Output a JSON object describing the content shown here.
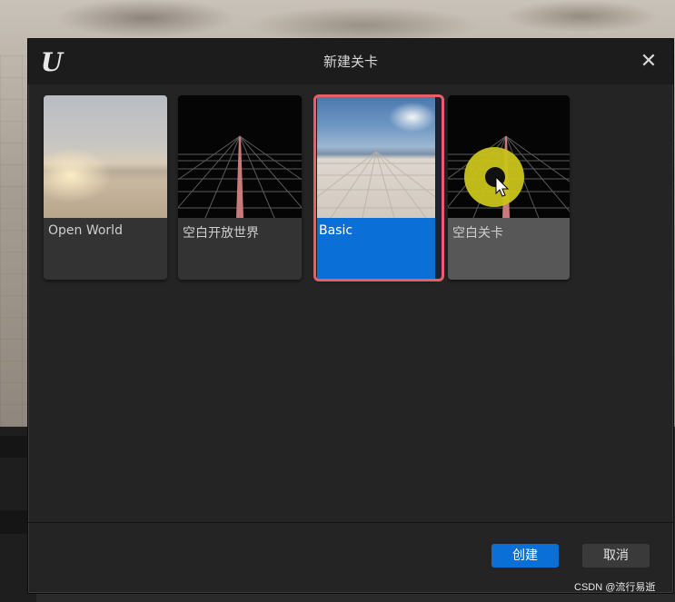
{
  "dialog": {
    "title": "新建关卡",
    "close_label": "✕",
    "logo_text": "U"
  },
  "templates": [
    {
      "label": "Open World",
      "selected": false
    },
    {
      "label": "空白开放世界",
      "selected": false
    },
    {
      "label": "Basic",
      "selected": true
    },
    {
      "label": "空白关卡",
      "selected": false
    }
  ],
  "footer": {
    "create_label": "创建",
    "cancel_label": "取消"
  },
  "watermark": "CSDN @流行易逝",
  "colors": {
    "accent": "#0a6fd6",
    "selection_outline": "#f05a6a",
    "cursor_highlight": "#c9c41a"
  },
  "icons": {
    "logo": "unreal-engine-logo-icon",
    "close": "close-icon",
    "pointer": "mouse-pointer-icon"
  }
}
